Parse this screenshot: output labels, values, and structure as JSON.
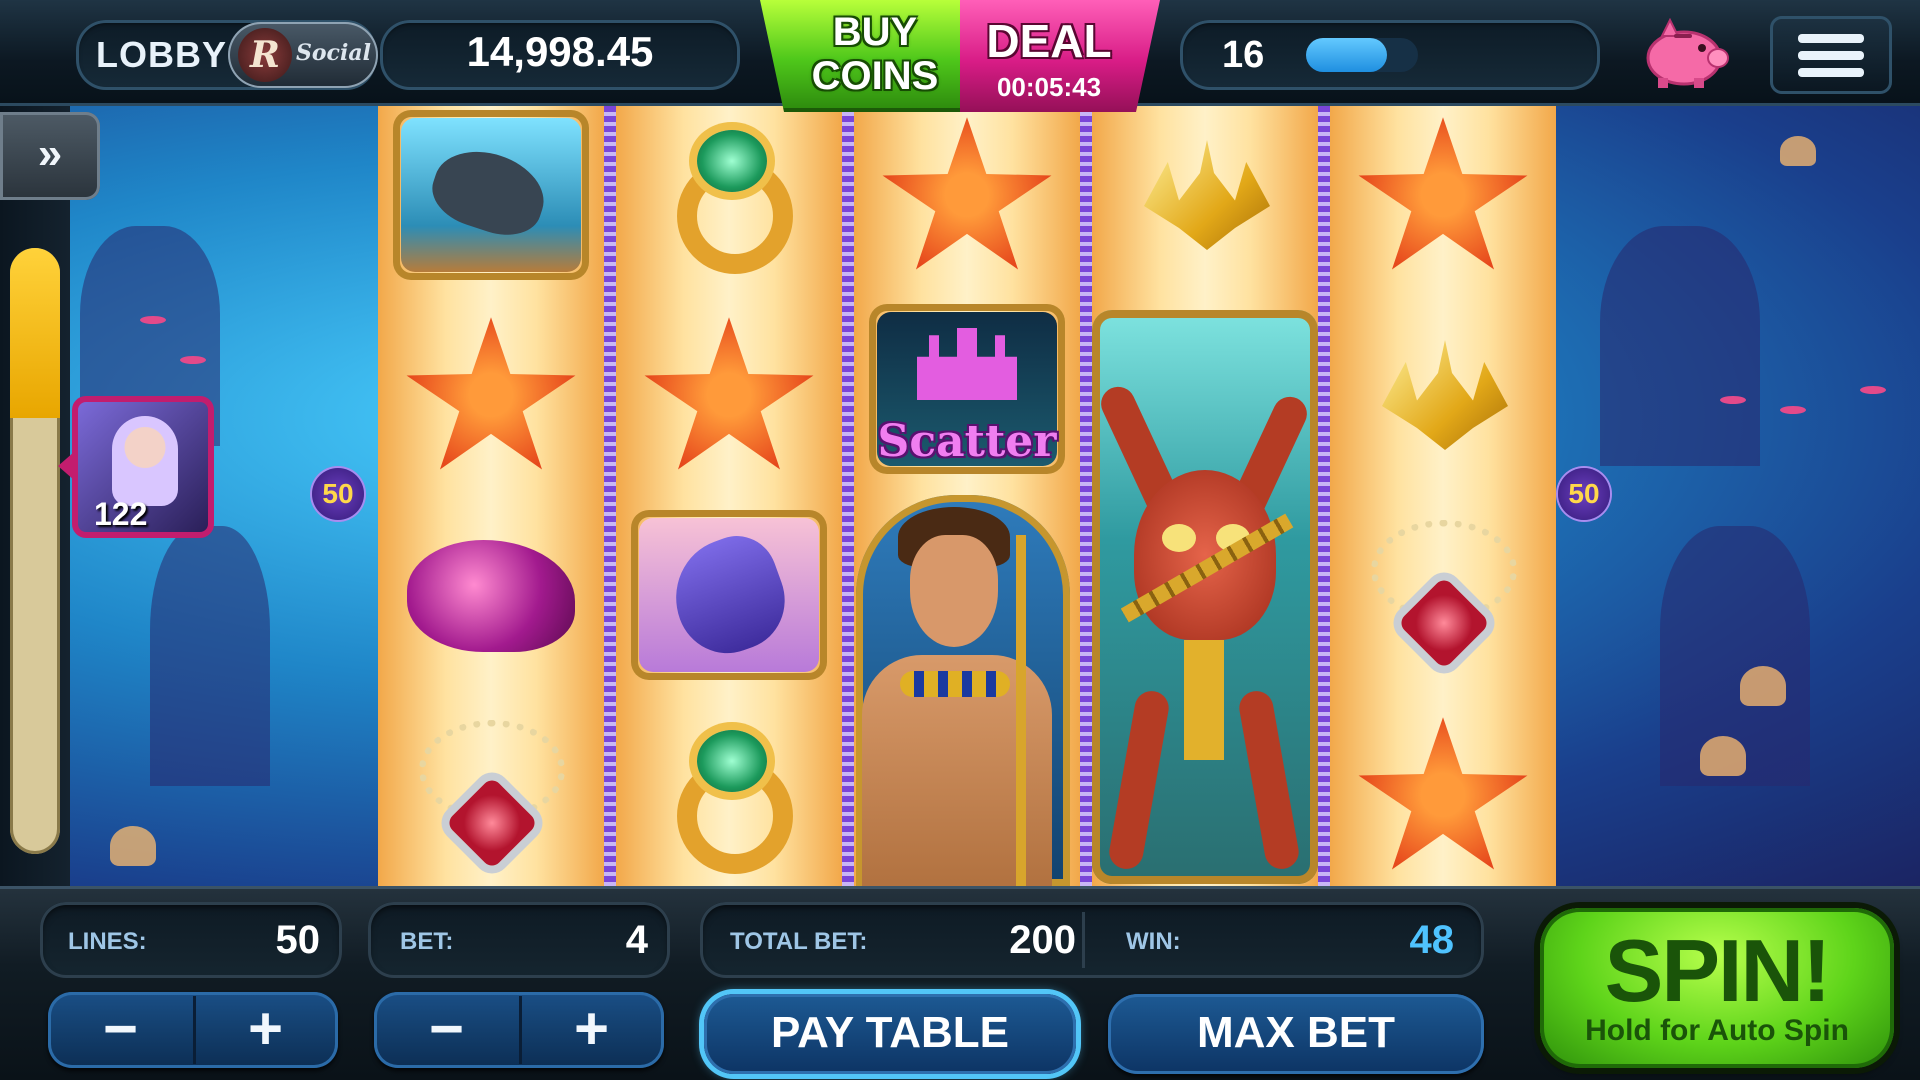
{
  "topbar": {
    "lobby_label": "LOBBY",
    "logo_letter": "R",
    "logo_text": "Social",
    "balance": "14,998.45",
    "buy_coins_label": "BUY\nCOINS",
    "deal_label": "DEAL",
    "deal_timer": "00:05:43",
    "level": "16",
    "xp_progress_fraction": 0.72
  },
  "side": {
    "expand_glyph": "»",
    "player_level": "122",
    "line_badge_left": "50",
    "line_badge_right": "50",
    "progress_fraction": 0.28
  },
  "reels": {
    "scatter_text": "Scatter",
    "symbols": [
      [
        "stingray",
        "starfish",
        "conch-shell",
        "necklace"
      ],
      [
        "emerald-ring",
        "starfish",
        "dolphin",
        "emerald-ring"
      ],
      [
        "starfish",
        "scatter",
        "merman-wild",
        "merman-wild"
      ],
      [
        "trident",
        "octopus-wild",
        "octopus-wild",
        "octopus-wild"
      ],
      [
        "starfish",
        "trident",
        "necklace",
        "starfish"
      ]
    ]
  },
  "bottombar": {
    "lines_label": "LINES:",
    "lines_value": "50",
    "bet_label": "BET:",
    "bet_value": "4",
    "total_bet_label": "TOTAL BET:",
    "total_bet_value": "200",
    "win_label": "WIN:",
    "win_value": "48",
    "minus_glyph": "−",
    "plus_glyph": "+",
    "pay_table_label": "PAY TABLE",
    "max_bet_label": "MAX BET",
    "spin_label": "SPIN!",
    "spin_sub_label": "Hold for Auto Spin"
  },
  "colors": {
    "win_value": "#4fc3ff",
    "buy_coins": "#4fc81b",
    "deal": "#d81c86",
    "spin": "#5ed41a"
  }
}
